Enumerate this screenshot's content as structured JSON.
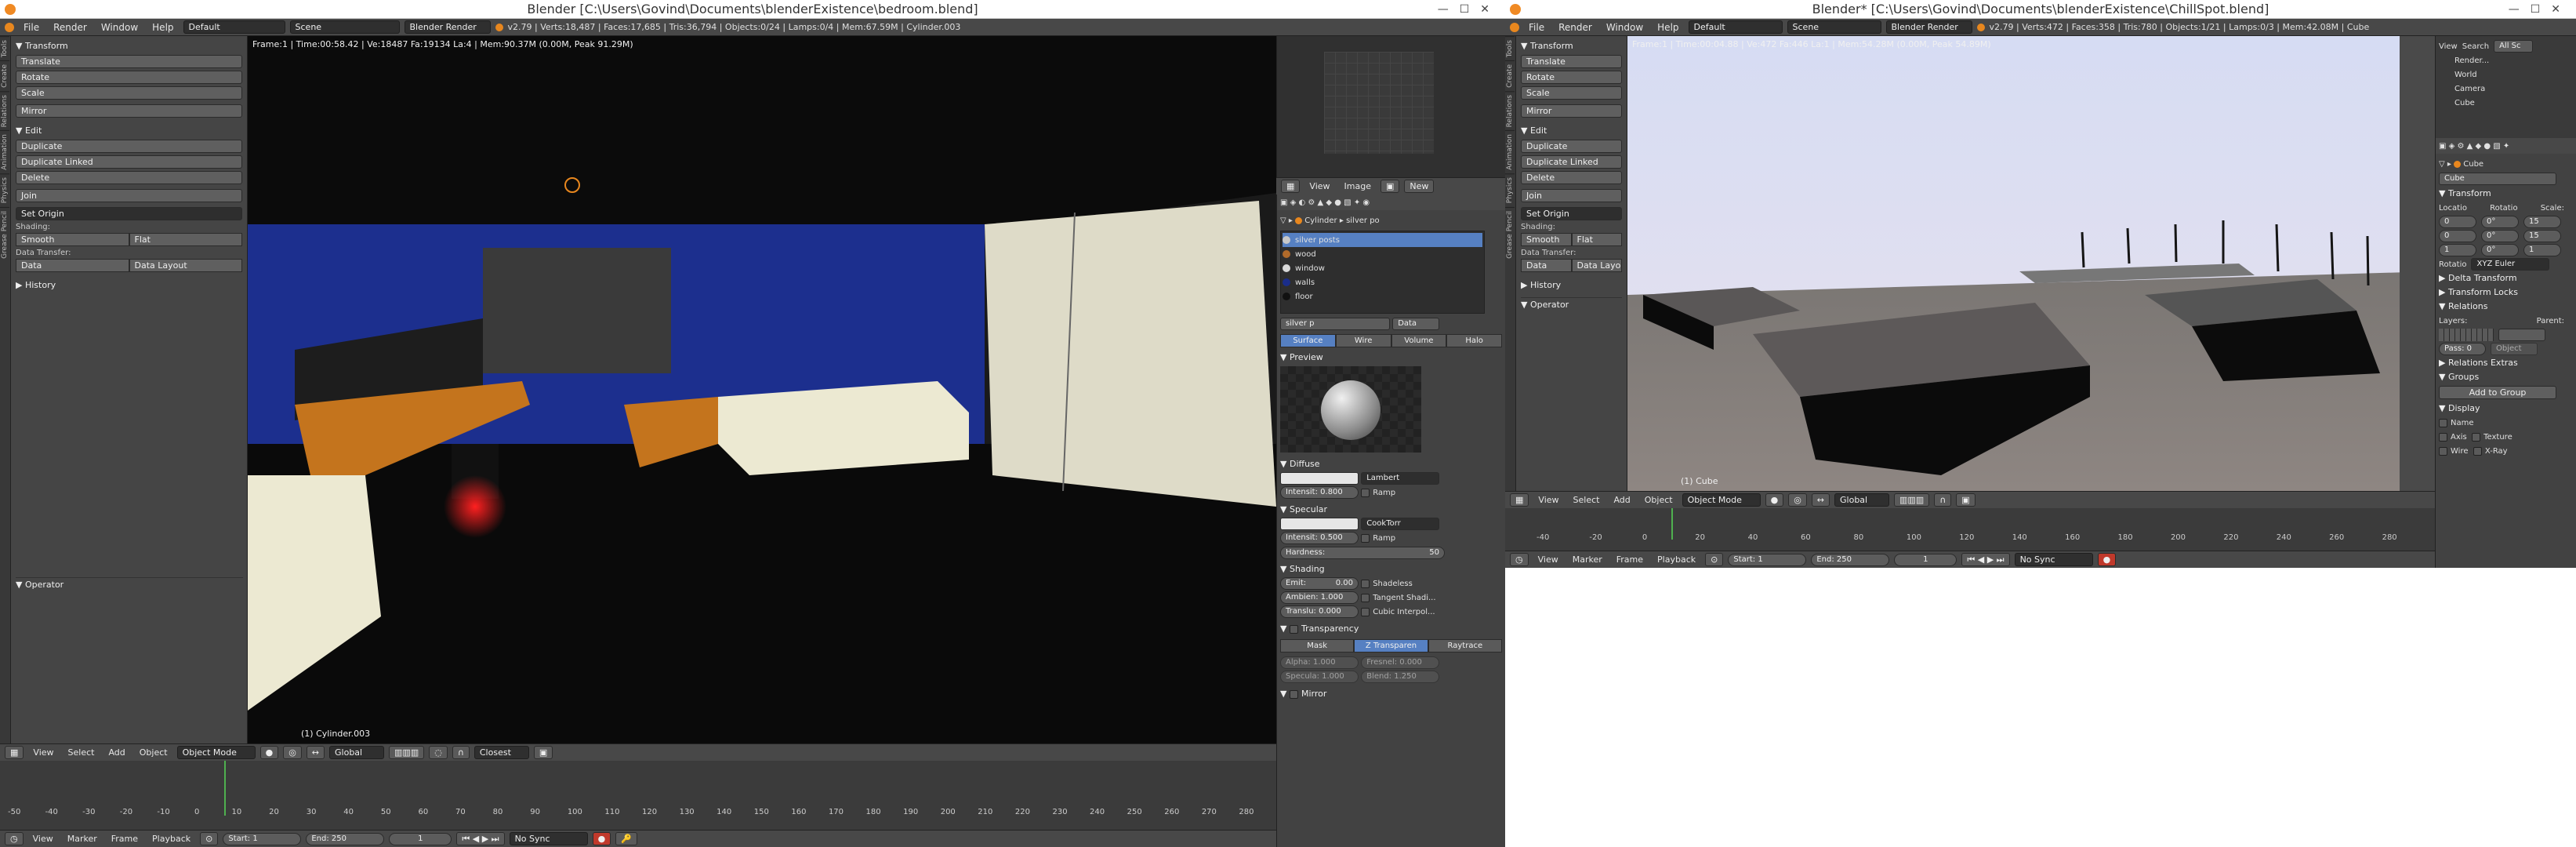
{
  "left_window": {
    "title": "Blender [C:\\Users\\Govind\\Documents\\blenderExistence\\bedroom.blend]",
    "menus": [
      "File",
      "Render",
      "Window",
      "Help"
    ],
    "screen_layout": "Default",
    "scene": "Scene",
    "render_engine": "Blender Render",
    "stats": "v2.79 | Verts:18,487 | Faces:17,685 | Tris:36,794 | Objects:0/24 | Lamps:0/4 | Mem:67.59M | Cylinder.003",
    "toolshelf": {
      "transform_header": "Transform",
      "transform_buttons": [
        "Translate",
        "Rotate",
        "Scale",
        "Mirror"
      ],
      "edit_header": "Edit",
      "edit_buttons": [
        "Duplicate",
        "Duplicate Linked",
        "Delete",
        "Join"
      ],
      "set_origin": "Set Origin",
      "shading_label": "Shading:",
      "smooth": "Smooth",
      "flat": "Flat",
      "data_transfer_label": "Data Transfer:",
      "data": "Data",
      "data_layout": "Data Layout",
      "history_header": "History",
      "operator_header": "Operator"
    },
    "tool_tabs": [
      "Tools",
      "Create",
      "Relations",
      "Animation",
      "Physics",
      "Grease Pencil"
    ],
    "viewport_info": "Frame:1 | Time:00:58.42 | Ve:18487 Fa:19134 La:4 | Mem:90.37M (0.00M, Peak 91.29M)",
    "viewport_object": "(1) Cylinder.003",
    "view_header": {
      "menus": [
        "View",
        "Select",
        "Add",
        "Object"
      ],
      "mode": "Object Mode",
      "orientation": "Global",
      "snap": "Closest"
    },
    "timeline_ticks": [
      "-50",
      "-40",
      "-30",
      "-20",
      "-10",
      "0",
      "10",
      "20",
      "30",
      "40",
      "50",
      "60",
      "70",
      "80",
      "90",
      "100",
      "110",
      "120",
      "130",
      "140",
      "150",
      "160",
      "170",
      "180",
      "190",
      "200",
      "210",
      "220",
      "230",
      "240",
      "250",
      "260",
      "270",
      "280"
    ],
    "timeline_header": {
      "menus": [
        "View",
        "Marker",
        "Frame",
        "Playback"
      ],
      "start_label": "Start:",
      "start": "1",
      "end_label": "End:",
      "end": "250",
      "current": "1",
      "sync": "No Sync"
    },
    "image_editor": {
      "menus": [
        "View",
        "Image"
      ],
      "new_button": "New"
    },
    "properties": {
      "context_object": "Cylinder",
      "context_material": "silver po",
      "materials": [
        {
          "name": "silver posts",
          "color": "#c8c8c8"
        },
        {
          "name": "wood",
          "color": "#b06a2a"
        },
        {
          "name": "window",
          "color": "#d8d8d8"
        },
        {
          "name": "walls",
          "color": "#1a2d8a"
        },
        {
          "name": "floor",
          "color": "#111111"
        }
      ],
      "material_field": "silver p",
      "data_label": "Data",
      "type_tabs": [
        "Surface",
        "Wire",
        "Volume",
        "Halo"
      ],
      "preview_header": "Preview",
      "diffuse_header": "Diffuse",
      "diffuse_shader": "Lambert",
      "diffuse_intensity": "Intensit: 0.800",
      "ramp": "Ramp",
      "specular_header": "Specular",
      "specular_shader": "CookTorr",
      "specular_intensity": "Intensit: 0.500",
      "hardness": "Hardness:",
      "hardness_value": "50",
      "shading_header": "Shading",
      "emit": "Emit:",
      "emit_value": "0.00",
      "ambient": "Ambien: 1.000",
      "translucency": "Translu: 0.000",
      "shadeless": "Shadeless",
      "tangent": "Tangent Shadi...",
      "cubic": "Cubic Interpol...",
      "transparency_header": "Transparency",
      "transp_tabs": [
        "Mask",
        "Z Transparen",
        "Raytrace"
      ],
      "alpha": "Alpha: 1.000",
      "fresnel": "Fresnel: 0.000",
      "specular_alpha": "Specula: 1.000",
      "blend": "Blend: 1.250",
      "mirror_header": "Mirror"
    }
  },
  "right_window": {
    "title": "Blender* [C:\\Users\\Govind\\Documents\\blenderExistence\\ChillSpot.blend]",
    "menus": [
      "File",
      "Render",
      "Window",
      "Help"
    ],
    "screen_layout": "Default",
    "scene": "Scene",
    "render_engine": "Blender Render",
    "stats": "v2.79 | Verts:472 | Faces:358 | Tris:780 | Objects:1/21 | Lamps:0/3 | Mem:42.08M | Cube",
    "toolshelf": {
      "transform_header": "Transform",
      "transform_buttons": [
        "Translate",
        "Rotate",
        "Scale",
        "Mirror"
      ],
      "edit_header": "Edit",
      "edit_buttons": [
        "Duplicate",
        "Duplicate Linked",
        "Delete",
        "Join"
      ],
      "set_origin": "Set Origin",
      "shading_label": "Shading:",
      "smooth": "Smooth",
      "flat": "Flat",
      "data_transfer_label": "Data Transfer:",
      "data": "Data",
      "data_layout": "Data Layo",
      "history_header": "History",
      "operator_header": "Operator"
    },
    "tool_tabs": [
      "Tools",
      "Create",
      "Relations",
      "Animation",
      "Physics",
      "Grease Pencil"
    ],
    "viewport_info": "Frame:1 | Time:00:04.88 | Ve:472 Fa:446 La:1 | Mem:54.28M (0.00M, Peak 54.89M)",
    "viewport_object": "(1) Cube",
    "view_header": {
      "menus": [
        "View",
        "Select",
        "Add",
        "Object"
      ],
      "mode": "Object Mode",
      "orientation": "Global"
    },
    "timeline_ticks": [
      "-40",
      "-20",
      "0",
      "20",
      "40",
      "60",
      "80",
      "100",
      "120",
      "140",
      "160",
      "180",
      "200",
      "220",
      "240",
      "260",
      "280"
    ],
    "timeline_header": {
      "menus": [
        "View",
        "Marker",
        "Frame",
        "Playback"
      ],
      "start_label": "Start:",
      "start": "1",
      "end_label": "End:",
      "end": "250",
      "current": "1",
      "sync": "No Sync"
    },
    "outliner": {
      "menus": [
        "View",
        "Search",
        "All Sc"
      ],
      "items": [
        "Render...",
        "World",
        "Camera",
        "Cube"
      ]
    },
    "properties": {
      "context_object": "Cube",
      "object_name": "Cube",
      "transform_header": "Transform",
      "location": "Locatio",
      "rotation": "Rotatio",
      "scale": "Scale:",
      "loc_values": [
        "0",
        "0",
        "1"
      ],
      "rot_values": [
        "0°",
        "0°",
        "0°"
      ],
      "scale_values": [
        "15",
        "15",
        "1"
      ],
      "rotation_mode_label": "Rotatio",
      "rotation_mode": "XYZ Euler",
      "delta_transform": "Delta Transform",
      "transform_locks": "Transform Locks",
      "relations": "Relations",
      "layers": "Layers:",
      "parent": "Parent:",
      "object_dd": "Object",
      "pass_index": "Pass: 0",
      "relations_extras": "Relations Extras",
      "groups": "Groups",
      "add_to_group": "Add to Group",
      "display": "Display",
      "display_items": [
        "Name",
        "Axis",
        "Wire",
        "Texture",
        "X-Ray"
      ]
    }
  }
}
